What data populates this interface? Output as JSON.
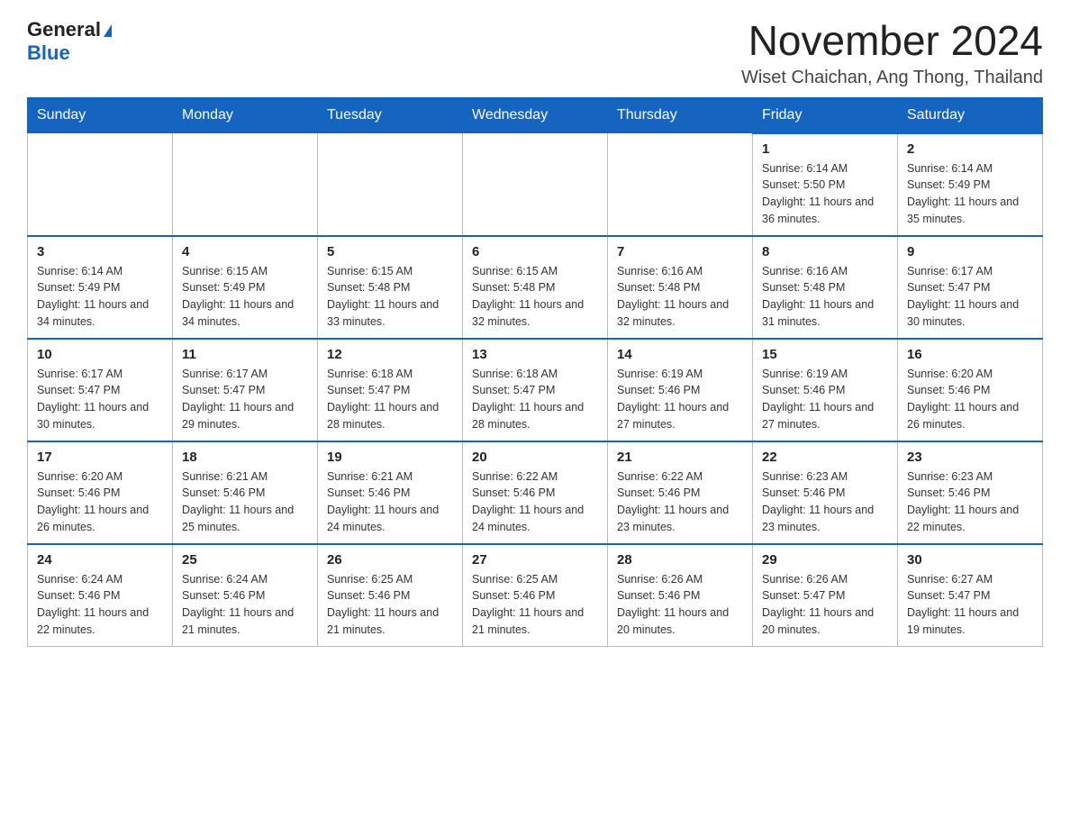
{
  "header": {
    "logo_general": "General",
    "logo_blue": "Blue",
    "month_title": "November 2024",
    "location": "Wiset Chaichan, Ang Thong, Thailand"
  },
  "days_of_week": [
    "Sunday",
    "Monday",
    "Tuesday",
    "Wednesday",
    "Thursday",
    "Friday",
    "Saturday"
  ],
  "weeks": [
    {
      "days": [
        {
          "number": "",
          "info": ""
        },
        {
          "number": "",
          "info": ""
        },
        {
          "number": "",
          "info": ""
        },
        {
          "number": "",
          "info": ""
        },
        {
          "number": "",
          "info": ""
        },
        {
          "number": "1",
          "info": "Sunrise: 6:14 AM\nSunset: 5:50 PM\nDaylight: 11 hours and 36 minutes."
        },
        {
          "number": "2",
          "info": "Sunrise: 6:14 AM\nSunset: 5:49 PM\nDaylight: 11 hours and 35 minutes."
        }
      ]
    },
    {
      "days": [
        {
          "number": "3",
          "info": "Sunrise: 6:14 AM\nSunset: 5:49 PM\nDaylight: 11 hours and 34 minutes."
        },
        {
          "number": "4",
          "info": "Sunrise: 6:15 AM\nSunset: 5:49 PM\nDaylight: 11 hours and 34 minutes."
        },
        {
          "number": "5",
          "info": "Sunrise: 6:15 AM\nSunset: 5:48 PM\nDaylight: 11 hours and 33 minutes."
        },
        {
          "number": "6",
          "info": "Sunrise: 6:15 AM\nSunset: 5:48 PM\nDaylight: 11 hours and 32 minutes."
        },
        {
          "number": "7",
          "info": "Sunrise: 6:16 AM\nSunset: 5:48 PM\nDaylight: 11 hours and 32 minutes."
        },
        {
          "number": "8",
          "info": "Sunrise: 6:16 AM\nSunset: 5:48 PM\nDaylight: 11 hours and 31 minutes."
        },
        {
          "number": "9",
          "info": "Sunrise: 6:17 AM\nSunset: 5:47 PM\nDaylight: 11 hours and 30 minutes."
        }
      ]
    },
    {
      "days": [
        {
          "number": "10",
          "info": "Sunrise: 6:17 AM\nSunset: 5:47 PM\nDaylight: 11 hours and 30 minutes."
        },
        {
          "number": "11",
          "info": "Sunrise: 6:17 AM\nSunset: 5:47 PM\nDaylight: 11 hours and 29 minutes."
        },
        {
          "number": "12",
          "info": "Sunrise: 6:18 AM\nSunset: 5:47 PM\nDaylight: 11 hours and 28 minutes."
        },
        {
          "number": "13",
          "info": "Sunrise: 6:18 AM\nSunset: 5:47 PM\nDaylight: 11 hours and 28 minutes."
        },
        {
          "number": "14",
          "info": "Sunrise: 6:19 AM\nSunset: 5:46 PM\nDaylight: 11 hours and 27 minutes."
        },
        {
          "number": "15",
          "info": "Sunrise: 6:19 AM\nSunset: 5:46 PM\nDaylight: 11 hours and 27 minutes."
        },
        {
          "number": "16",
          "info": "Sunrise: 6:20 AM\nSunset: 5:46 PM\nDaylight: 11 hours and 26 minutes."
        }
      ]
    },
    {
      "days": [
        {
          "number": "17",
          "info": "Sunrise: 6:20 AM\nSunset: 5:46 PM\nDaylight: 11 hours and 26 minutes."
        },
        {
          "number": "18",
          "info": "Sunrise: 6:21 AM\nSunset: 5:46 PM\nDaylight: 11 hours and 25 minutes."
        },
        {
          "number": "19",
          "info": "Sunrise: 6:21 AM\nSunset: 5:46 PM\nDaylight: 11 hours and 24 minutes."
        },
        {
          "number": "20",
          "info": "Sunrise: 6:22 AM\nSunset: 5:46 PM\nDaylight: 11 hours and 24 minutes."
        },
        {
          "number": "21",
          "info": "Sunrise: 6:22 AM\nSunset: 5:46 PM\nDaylight: 11 hours and 23 minutes."
        },
        {
          "number": "22",
          "info": "Sunrise: 6:23 AM\nSunset: 5:46 PM\nDaylight: 11 hours and 23 minutes."
        },
        {
          "number": "23",
          "info": "Sunrise: 6:23 AM\nSunset: 5:46 PM\nDaylight: 11 hours and 22 minutes."
        }
      ]
    },
    {
      "days": [
        {
          "number": "24",
          "info": "Sunrise: 6:24 AM\nSunset: 5:46 PM\nDaylight: 11 hours and 22 minutes."
        },
        {
          "number": "25",
          "info": "Sunrise: 6:24 AM\nSunset: 5:46 PM\nDaylight: 11 hours and 21 minutes."
        },
        {
          "number": "26",
          "info": "Sunrise: 6:25 AM\nSunset: 5:46 PM\nDaylight: 11 hours and 21 minutes."
        },
        {
          "number": "27",
          "info": "Sunrise: 6:25 AM\nSunset: 5:46 PM\nDaylight: 11 hours and 21 minutes."
        },
        {
          "number": "28",
          "info": "Sunrise: 6:26 AM\nSunset: 5:46 PM\nDaylight: 11 hours and 20 minutes."
        },
        {
          "number": "29",
          "info": "Sunrise: 6:26 AM\nSunset: 5:47 PM\nDaylight: 11 hours and 20 minutes."
        },
        {
          "number": "30",
          "info": "Sunrise: 6:27 AM\nSunset: 5:47 PM\nDaylight: 11 hours and 19 minutes."
        }
      ]
    }
  ]
}
